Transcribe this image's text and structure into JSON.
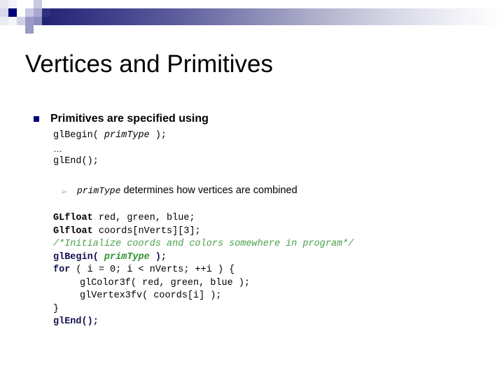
{
  "slide": {
    "title": "Vertices and Primitives",
    "decoration": {
      "accent_dark": "#00007a",
      "accent_mid": "#9a9ac8",
      "accent_light": "#c9c9e2",
      "gradient_from": "#1d1d6e",
      "gradient_to": "#ffffff"
    },
    "bullets": [
      {
        "level": 1,
        "marker": "square-bullet",
        "text": "Primitives are specified using"
      }
    ],
    "code_block_1": {
      "line_1_pre": "glBegin( ",
      "line_1_var": "primType",
      "line_1_post": " );",
      "line_2": "…",
      "line_3": "glEnd();"
    },
    "sub_bullet": {
      "level": 2,
      "marker": "➢",
      "marker_name": "arrow-bullet",
      "var": "primType",
      "text": " determines how vertices are combined"
    },
    "code_block_2": {
      "line_1_kw": "GLfloat",
      "line_1_rest": " red, green, blue;",
      "line_2_kw": "Glfloat",
      "line_2_rest": " coords[nVerts][3];",
      "line_3_comment": "/*Initialize coords and colors somewhere in program*/",
      "line_4_pre": "glBegin( ",
      "line_4_var": "primType",
      "line_4_post": " );",
      "line_5_kw": "for",
      "line_5_rest": " ( i = 0; i < nVerts; ++i ) {",
      "line_6": "glColor3f( red, green, blue );",
      "line_7": "glVertex3fv( coords[i] );",
      "line_8": "}",
      "line_9": "glEnd();"
    },
    "colors": {
      "comment_green": "#4aa04a",
      "keyword_navy": "#11114f",
      "variable_green": "#2f9130",
      "text_black": "#000000"
    }
  }
}
